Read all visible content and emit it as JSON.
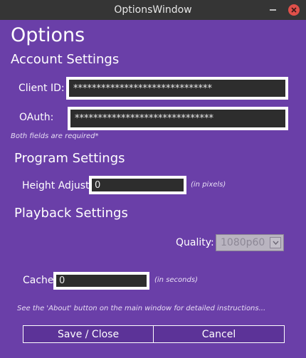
{
  "window": {
    "title": "OptionsWindow"
  },
  "page": {
    "heading": "Options"
  },
  "account": {
    "heading": "Account Settings",
    "client_id_label": "Client ID:",
    "client_id_value": "******************************",
    "oauth_label": "OAuth:",
    "oauth_value": "******************************",
    "required_note": "Both fields are required*"
  },
  "program": {
    "heading": "Program Settings",
    "height_label": "Height Adjust:",
    "height_value": "0",
    "height_unit": "(in pixels)"
  },
  "playback": {
    "heading": "Playback Settings",
    "quality_label": "Quality:",
    "quality_value": "1080p60",
    "cache_label": "Cache:",
    "cache_value": "0",
    "cache_unit": "(in seconds)"
  },
  "footer": {
    "instructions": "See the 'About' button on the main window for detailed instructions...",
    "save_label": "Save / Close",
    "cancel_label": "Cancel"
  },
  "colors": {
    "background": "#6a3fa8",
    "titlebar": "#353535",
    "field": "#2d2d2d",
    "close": "#e0504a"
  }
}
